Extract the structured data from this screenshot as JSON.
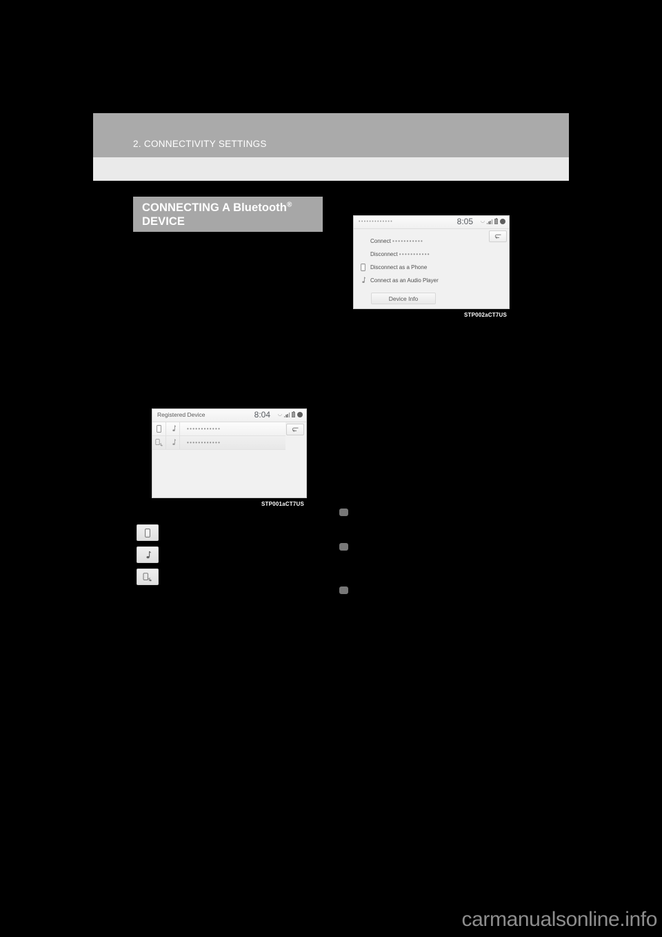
{
  "page": {
    "chapter_header": "2. CONNECTIVITY SETTINGS",
    "section_title_main": "CONNECTING A Bluetooth",
    "section_title_sup": "®",
    "section_title_line2": "DEVICE",
    "watermark": "carmanualsonline.info",
    "background_color": "#000000",
    "header_bar_color": "#aaaaaa",
    "header_band_color": "#eaeaea",
    "section_box_color": "#a7a7a7"
  },
  "figures": [
    {
      "id": "registered-device-screen",
      "caption": "STP001aCT7US",
      "screen": {
        "title": "Registered Device",
        "title_redacted": false,
        "clock": "8:04",
        "status_icons": [
          "signal-bars-icon",
          "battery-icon",
          "bluetooth-icon"
        ],
        "back_button_icon": "back-arrow-icon",
        "rows": [
          {
            "phone_icon": "phone-icon",
            "audio_icon": "music-note-icon",
            "device_name": "••••••••••••",
            "selected": true
          },
          {
            "phone_icon": "phone-network-icon",
            "audio_icon": "music-note-icon",
            "device_name": "••••••••••••",
            "selected": false
          }
        ]
      }
    },
    {
      "id": "device-options-screen",
      "caption": "STP002aCT7US",
      "screen": {
        "title": "•••••••••••••",
        "title_redacted": true,
        "clock": "8:05",
        "status_icons": [
          "signal-bars-icon",
          "battery-icon",
          "bluetooth-icon"
        ],
        "back_button_icon": "back-arrow-icon",
        "menu_items": [
          {
            "icon": "",
            "label": "Connect ",
            "dots": "•••••••••••"
          },
          {
            "icon": "",
            "label": "Disconnect ",
            "dots": "•••••••••••"
          },
          {
            "icon": "phone-icon",
            "label": "Disconnect as a Phone",
            "dots": ""
          },
          {
            "icon": "music-note-icon",
            "label": "Connect as an Audio Player",
            "dots": ""
          }
        ],
        "device_info_button": "Device Info"
      }
    }
  ],
  "icon_keys": [
    {
      "name": "phone-icon"
    },
    {
      "name": "music-note-icon"
    },
    {
      "name": "phone-network-icon"
    }
  ],
  "bullets": [
    {
      "name": "bullet-1"
    },
    {
      "name": "bullet-2"
    },
    {
      "name": "bullet-3"
    }
  ]
}
